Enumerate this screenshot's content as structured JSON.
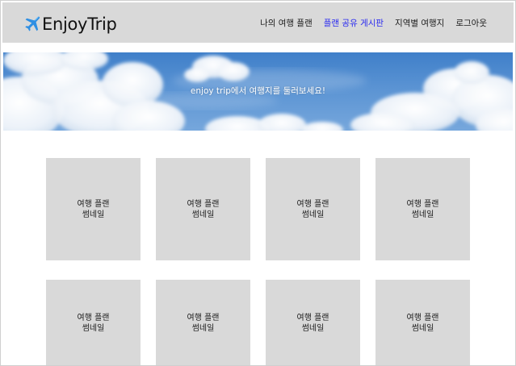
{
  "header": {
    "logo_text": "EnjoyTrip",
    "logo_icon": "airplane-icon",
    "nav": [
      {
        "label": "나의 여행 플랜",
        "active": false
      },
      {
        "label": "플랜 공유 게시판",
        "active": true
      },
      {
        "label": "지역별 여행지",
        "active": false
      },
      {
        "label": "로그아웃",
        "active": false
      }
    ],
    "active_color": "#2a2af0"
  },
  "banner": {
    "text": "enjoy trip에서 여행지를 둘러보세요!"
  },
  "grid": {
    "items": [
      {
        "label": "여행 플랜\n썸네일"
      },
      {
        "label": "여행 플랜\n썸네일"
      },
      {
        "label": "여행 플랜\n썸네일"
      },
      {
        "label": "여행 플랜\n썸네일"
      },
      {
        "label": "여행 플랜\n썸네일"
      },
      {
        "label": "여행 플랜\n썸네일"
      },
      {
        "label": "여행 플랜\n썸네일"
      },
      {
        "label": "여행 플랜\n썸네일"
      }
    ]
  }
}
